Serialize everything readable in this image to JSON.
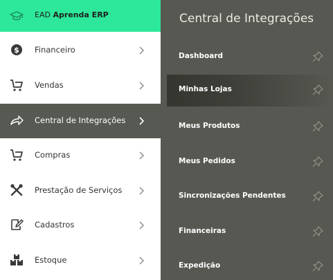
{
  "brand": {
    "prefix": "EAD",
    "name": "Aprenda ERP",
    "icon": "graduation-cap-icon"
  },
  "menu": {
    "items": [
      {
        "label": "Financeiro",
        "icon": "dollar-coin-icon"
      },
      {
        "label": "Vendas",
        "icon": "cart-icon"
      },
      {
        "label": "Central de Integrações",
        "icon": "share-arrow-icon"
      },
      {
        "label": "Compras",
        "icon": "cart-icon"
      },
      {
        "label": "Prestação de Serviços",
        "icon": "tools-icon"
      },
      {
        "label": "Cadastros",
        "icon": "edit-icon"
      },
      {
        "label": "Estoque",
        "icon": "boxes-icon"
      }
    ],
    "active_index": 2
  },
  "submenu": {
    "title": "Central de Integrações",
    "items": [
      {
        "label": "Dashboard"
      },
      {
        "label": "Minhas Lojas"
      },
      {
        "label": "Meus Produtos"
      },
      {
        "label": "Meus Pedidos"
      },
      {
        "label": "Sincronizações Pendentes"
      },
      {
        "label": "Financeiras"
      },
      {
        "label": "Expedição"
      }
    ],
    "active_index": 1
  },
  "colors": {
    "brand_bg": "#2de89a",
    "panel_bg": "#575851",
    "active_menu_bg": "#565a52"
  }
}
